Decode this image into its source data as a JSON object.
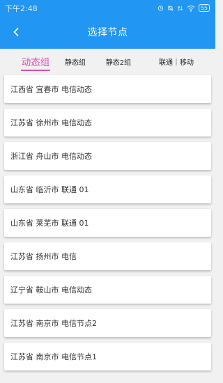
{
  "status_bar": {
    "time": "下午2:48",
    "battery": "55"
  },
  "header": {
    "title": "选择节点",
    "background_color": "#2196f3"
  },
  "tabs": [
    {
      "label": "动态组",
      "active": true
    },
    {
      "label": "静态组",
      "active": false
    },
    {
      "label": "静态2组",
      "active": false
    },
    {
      "label": "联通｜移动",
      "active": false
    }
  ],
  "accent_color": "#d84fae",
  "nodes": [
    {
      "label": "江西省 宜春市 电信动态"
    },
    {
      "label": "江苏省 徐州市 电信动态"
    },
    {
      "label": "浙江省 舟山市 电信动态"
    },
    {
      "label": "山东省 临沂市  联通 01"
    },
    {
      "label": "山东省 莱芜市  联通 01"
    },
    {
      "label": "江苏省 扬州市 电信"
    },
    {
      "label": "辽宁省 鞍山市 电信动态"
    },
    {
      "label": "江苏省 南京市 电信节点2"
    },
    {
      "label": "江苏省 南京市 电信节点1"
    }
  ]
}
